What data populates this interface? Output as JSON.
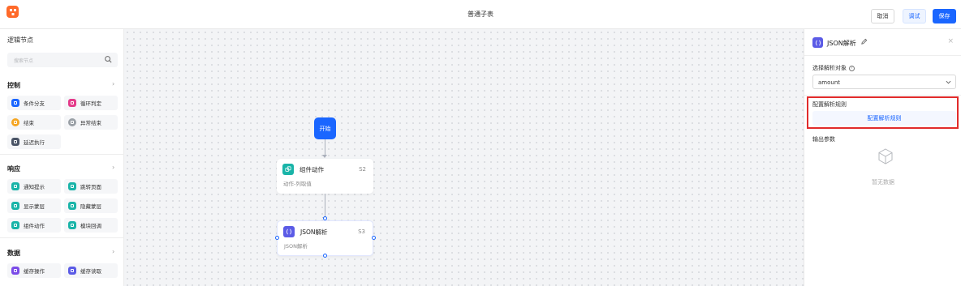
{
  "header": {
    "title": "普通子表",
    "cancel_label": "取消",
    "debug_label": "调试",
    "save_label": "保存"
  },
  "left_panel": {
    "title": "逻辑节点",
    "search_placeholder": "搜索节点",
    "sections": [
      {
        "title": "控制",
        "items": [
          {
            "label": "条件分支",
            "color": "#1a66ff",
            "icon": "branch-icon"
          },
          {
            "label": "循环判定",
            "color": "#e43b8a",
            "icon": "loop-icon"
          },
          {
            "label": "结束",
            "color": "#f5a623",
            "icon": "end-icon"
          },
          {
            "label": "异常结束",
            "color": "#9aa0a6",
            "icon": "error-end-icon"
          },
          {
            "label": "延迟执行",
            "color": "#4a5466",
            "icon": "delay-icon"
          }
        ]
      },
      {
        "title": "响应",
        "items": [
          {
            "label": "通知提示",
            "color": "#19b4a8",
            "icon": "notify-icon"
          },
          {
            "label": "跳转页面",
            "color": "#19b4a8",
            "icon": "jump-icon"
          },
          {
            "label": "显示蒙层",
            "color": "#19b4a8",
            "icon": "show-mask-icon"
          },
          {
            "label": "隐藏蒙层",
            "color": "#19b4a8",
            "icon": "hide-mask-icon"
          },
          {
            "label": "组件动作",
            "color": "#19b4a8",
            "icon": "component-action-icon"
          },
          {
            "label": "模块回调",
            "color": "#19b4a8",
            "icon": "module-callback-icon"
          }
        ]
      },
      {
        "title": "数据",
        "items": [
          {
            "label": "缓存操作",
            "color": "#7b4be8",
            "icon": "cache-op-icon"
          },
          {
            "label": "缓存读取",
            "color": "#5b5be6",
            "icon": "cache-read-icon"
          }
        ]
      }
    ]
  },
  "canvas": {
    "start_label": "开始",
    "nodes": [
      {
        "title": "组件动作",
        "id": "S2",
        "subtitle": "动作-列取值",
        "color": "#19b4a8"
      },
      {
        "title": "JSON解析",
        "id": "S3",
        "subtitle": "JSON解析",
        "color": "#5b5be6"
      }
    ]
  },
  "right_panel": {
    "title": "JSON解析",
    "select_label": "选择解析对象",
    "select_value": "amount",
    "config_label": "配置解析规则",
    "config_button": "配置解析规则",
    "output_label": "输出参数",
    "empty_text": "暂无数据"
  }
}
